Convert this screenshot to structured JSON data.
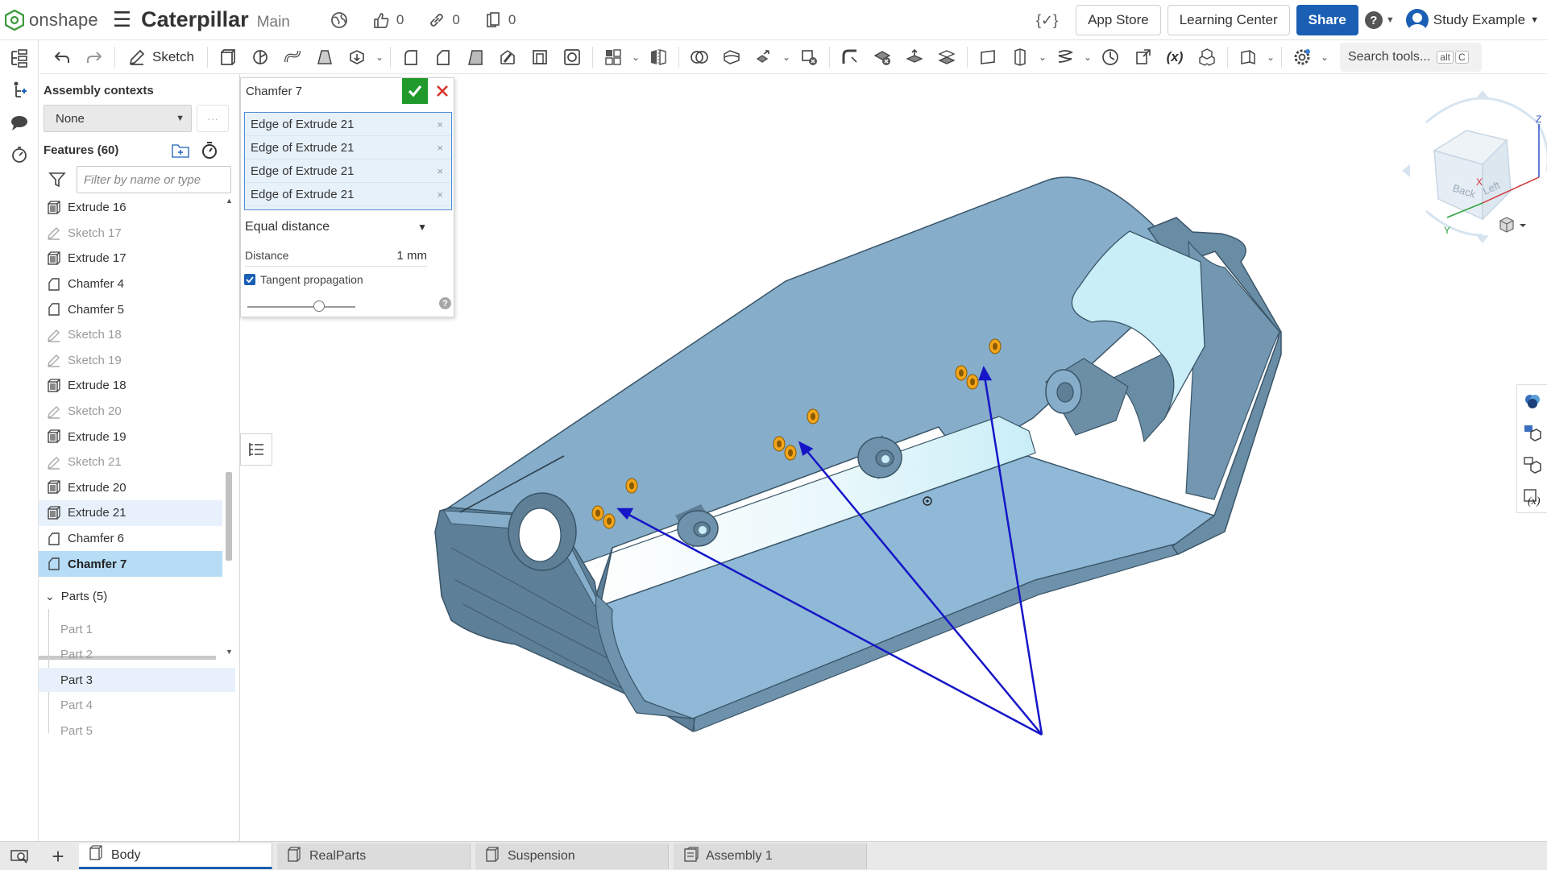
{
  "header": {
    "logo_text": "onshape",
    "doc_title": "Caterpillar",
    "branch": "Main",
    "likes": "0",
    "links": "0",
    "copies": "0",
    "variable_icon": "{✓}",
    "app_store": "App Store",
    "learning_center": "Learning Center",
    "share": "Share",
    "help": "?",
    "user": "Study Example"
  },
  "toolbar": {
    "sketch_label": "Sketch",
    "search_label": "Search tools...",
    "search_key1": "alt",
    "search_key2": "C",
    "fx_label": "(x)"
  },
  "panel": {
    "assembly_contexts_title": "Assembly contexts",
    "assembly_context_value": "None",
    "more_label": "···",
    "features_title": "Features (60)",
    "filter_placeholder": "Filter by name or type",
    "features": [
      {
        "label": "Extrude 16",
        "kind": "extrude"
      },
      {
        "label": "Sketch 17",
        "kind": "sketch"
      },
      {
        "label": "Extrude 17",
        "kind": "extrude"
      },
      {
        "label": "Chamfer 4",
        "kind": "chamfer"
      },
      {
        "label": "Chamfer 5",
        "kind": "chamfer"
      },
      {
        "label": "Sketch 18",
        "kind": "sketch"
      },
      {
        "label": "Sketch 19",
        "kind": "sketch"
      },
      {
        "label": "Extrude 18",
        "kind": "extrude"
      },
      {
        "label": "Sketch 20",
        "kind": "sketch"
      },
      {
        "label": "Extrude 19",
        "kind": "extrude"
      },
      {
        "label": "Sketch 21",
        "kind": "sketch"
      },
      {
        "label": "Extrude 20",
        "kind": "extrude"
      },
      {
        "label": "Extrude 21",
        "kind": "extrude",
        "state": "hl"
      },
      {
        "label": "Chamfer 6",
        "kind": "chamfer"
      },
      {
        "label": "Chamfer 7",
        "kind": "chamfer",
        "state": "sel"
      }
    ],
    "parts_title": "Parts (5)",
    "parts": [
      {
        "label": "Part 1"
      },
      {
        "label": "Part 2"
      },
      {
        "label": "Part 3",
        "state": "hl"
      },
      {
        "label": "Part 4"
      },
      {
        "label": "Part 5"
      }
    ]
  },
  "dialog": {
    "title": "Chamfer 7",
    "selections": [
      "Edge of Extrude 21",
      "Edge of Extrude 21",
      "Edge of Extrude 21",
      "Edge of Extrude 21"
    ],
    "remove_glyph": "×",
    "type_value": "Equal distance",
    "distance_label": "Distance",
    "distance_value": "1 mm",
    "tangent_label": "Tangent propagation",
    "tangent_checked": true,
    "help_glyph": "?"
  },
  "viewcube": {
    "face_front": "Back",
    "face_right": "Left",
    "axis_x": "X",
    "axis_y": "Y",
    "axis_z": "Z"
  },
  "tabs": [
    {
      "label": "Body",
      "active": true,
      "icon": "part-studio-icon"
    },
    {
      "label": "RealParts",
      "active": false,
      "icon": "part-studio-icon"
    },
    {
      "label": "Suspension",
      "active": false,
      "icon": "part-studio-icon"
    },
    {
      "label": "Assembly 1",
      "active": false,
      "icon": "assembly-icon"
    }
  ],
  "colors": {
    "accent": "#1a5fb4",
    "part_face": "#8fb9d6",
    "part_dark": "#5d7f97",
    "selected_edge": "#f2a51a",
    "arrow": "#1616c8",
    "ok_green": "#1f9a2b",
    "cancel_red": "#d9342b"
  }
}
